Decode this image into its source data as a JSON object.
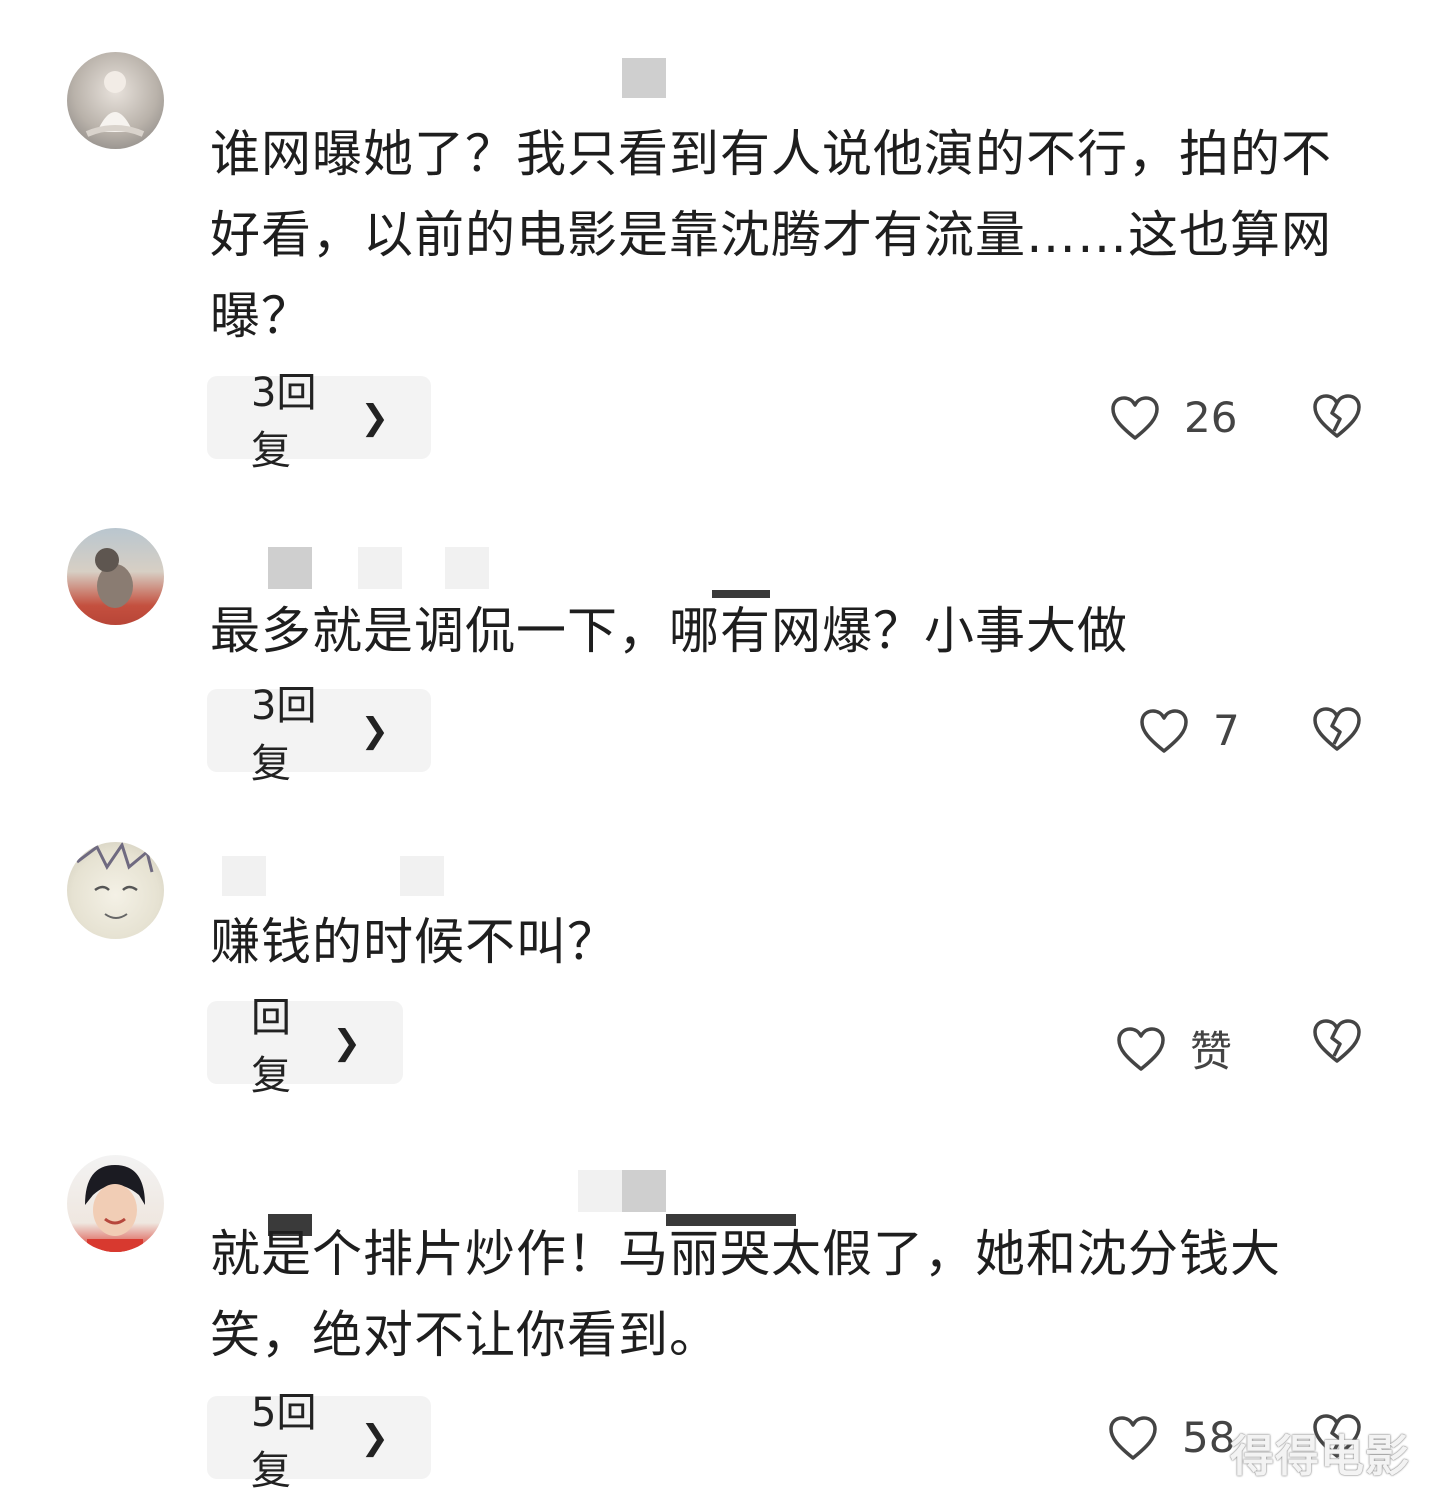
{
  "comments": [
    {
      "text": "谁网曝她了？我只看到有人说他演的不行，拍的不好看，以前的电影是靠沈腾才有流量……这也算网曝？",
      "reply_label": "3回复",
      "likes": "26"
    },
    {
      "text": "最多就是调侃一下，哪有网爆？小事大做",
      "reply_label": "3回复",
      "likes": "7"
    },
    {
      "text": "赚钱的时候不叫？",
      "reply_label": "回复",
      "likes": "赞"
    },
    {
      "text": "就是个排片炒作！马丽哭太假了，她和沈分钱大笑，绝对不让你看到。",
      "reply_label": "5回复",
      "likes": "58"
    }
  ],
  "icons": {
    "reply_chevron": "chevron-right-icon",
    "like": "heart-outline-icon",
    "dislike": "broken-heart-icon"
  },
  "watermark": "得得电影"
}
